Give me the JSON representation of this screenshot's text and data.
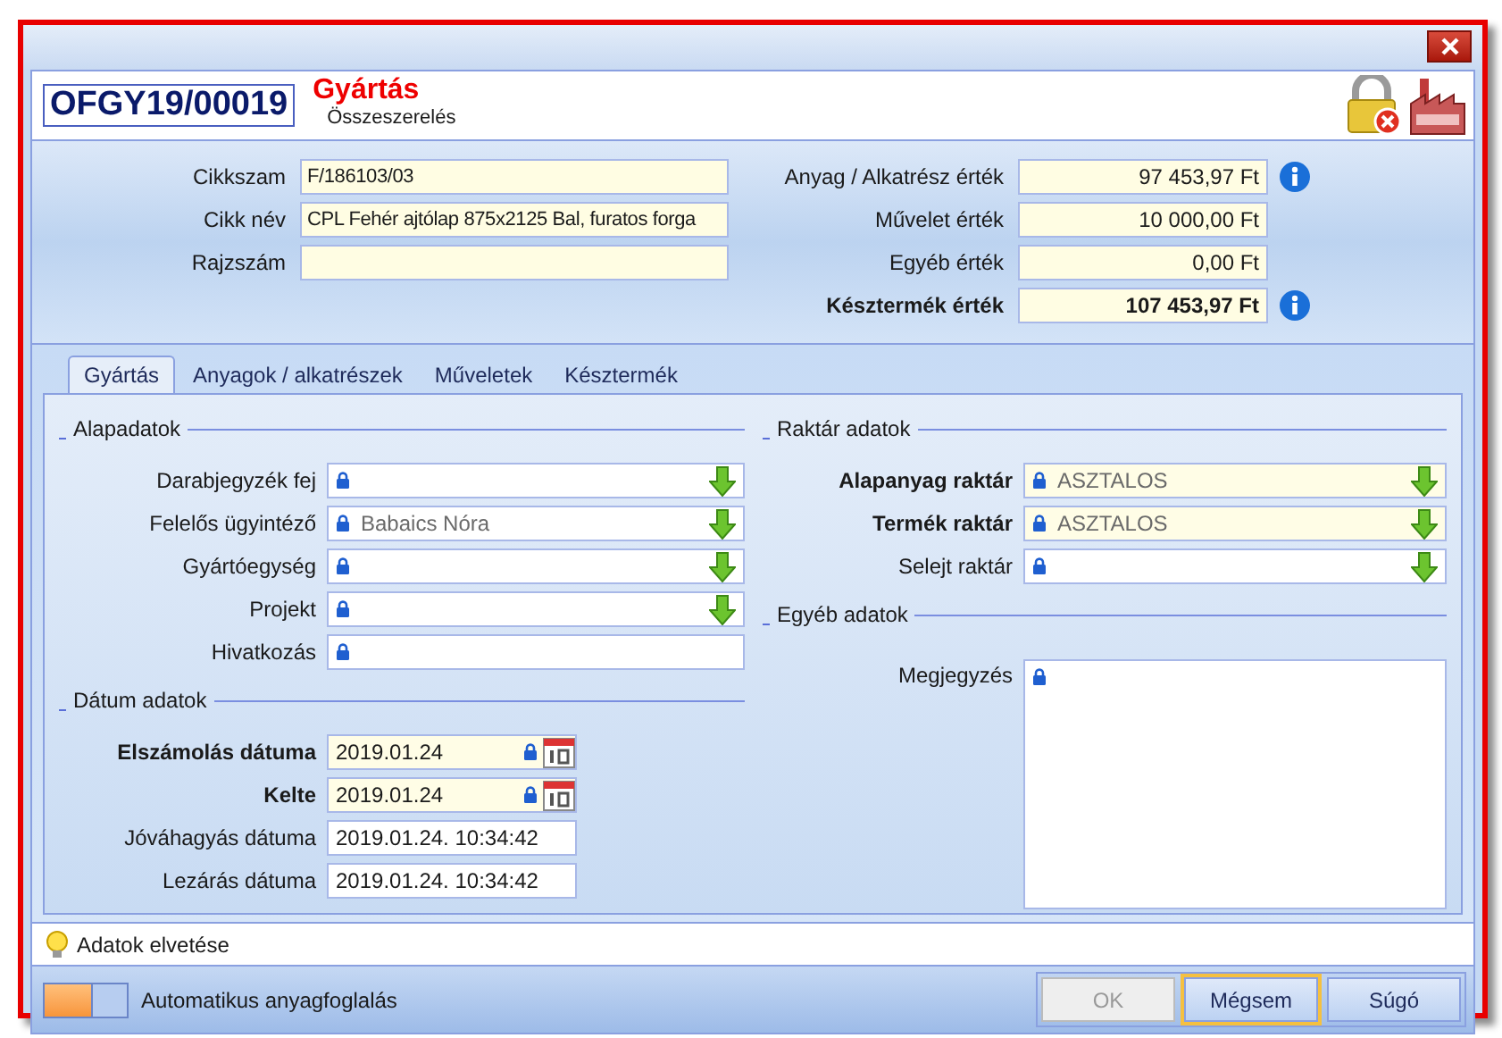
{
  "header": {
    "document_number": "OFGY19/00019",
    "title": "Gyártás",
    "subtitle": "Összeszerelés"
  },
  "summary": {
    "left": [
      {
        "label": "Cikkszam",
        "value": "F/186103/03"
      },
      {
        "label": "Cikk név",
        "value": "CPL Fehér ajtólap 875x2125 Bal, furatos forga"
      },
      {
        "label": "Rajzszám"
      }
    ],
    "right": [
      {
        "label": "Anyag / Alkatrész érték",
        "value": "97 453,97 Ft",
        "info": true,
        "bold": false
      },
      {
        "label": "Művelet érték",
        "value": "10 000,00 Ft",
        "info": false,
        "bold": false
      },
      {
        "label": "Egyéb érték",
        "value": "0,00 Ft",
        "info": false,
        "bold": false
      },
      {
        "label": "Késztermék érték",
        "value": "107 453,97 Ft",
        "info": true,
        "bold": true
      }
    ]
  },
  "tabs": [
    {
      "label": "Gyártás",
      "selected": true
    },
    {
      "label": "Anyagok / alkatrészek",
      "selected": false
    },
    {
      "label": "Műveletek",
      "selected": false
    },
    {
      "label": "Késztermék",
      "selected": false
    }
  ],
  "columns": [
    {
      "groups": [
        {
          "title": "Alapadatok",
          "fields": [
            {
              "label": "Darabjegyzék fej",
              "kind": "combo",
              "required": false
            },
            {
              "label": "Felelős ügyintéző",
              "kind": "combo",
              "value": "Babaics Nóra",
              "required": false
            },
            {
              "label": "Gyártóegység",
              "kind": "combo",
              "required": false
            },
            {
              "label": "Projekt",
              "kind": "combo",
              "required": false
            },
            {
              "label": "Hivatkozás",
              "kind": "text",
              "required": false
            }
          ]
        },
        {
          "title": "Dátum adatok",
          "fields": [
            {
              "label": "Elszámolás dátuma",
              "kind": "date",
              "value": "2019.01.24",
              "required": true
            },
            {
              "label": "Kelte",
              "kind": "date",
              "value": "2019.01.24",
              "required": true
            },
            {
              "label": "Jóváhagyás dátuma",
              "kind": "plain",
              "value": "2019.01.24. 10:34:42",
              "required": false
            },
            {
              "label": "Lezárás dátuma",
              "kind": "plain",
              "value": "2019.01.24. 10:34:42",
              "required": false
            }
          ]
        }
      ]
    },
    {
      "groups": [
        {
          "title": "Raktár adatok",
          "fields": [
            {
              "label": "Alapanyag raktár",
              "kind": "combo",
              "value": "ASZTALOS",
              "required": true
            },
            {
              "label": "Termék raktár",
              "kind": "combo",
              "value": "ASZTALOS",
              "required": true
            },
            {
              "label": "Selejt raktár",
              "kind": "combo",
              "required": false
            }
          ]
        },
        {
          "title": "Egyéb adatok",
          "fields": [
            {
              "label": "Megjegyzés",
              "kind": "memo",
              "required": false
            }
          ]
        }
      ]
    }
  ],
  "hint": "Adatok elvetése",
  "auto_reservation": {
    "label": "Automatikus anyagfoglalás",
    "on": true
  },
  "buttons": [
    {
      "label": "OK",
      "disabled": true,
      "focused": false
    },
    {
      "label": "Mégsem",
      "disabled": false,
      "focused": true
    },
    {
      "label": "Súgó",
      "disabled": false,
      "focused": false
    }
  ]
}
